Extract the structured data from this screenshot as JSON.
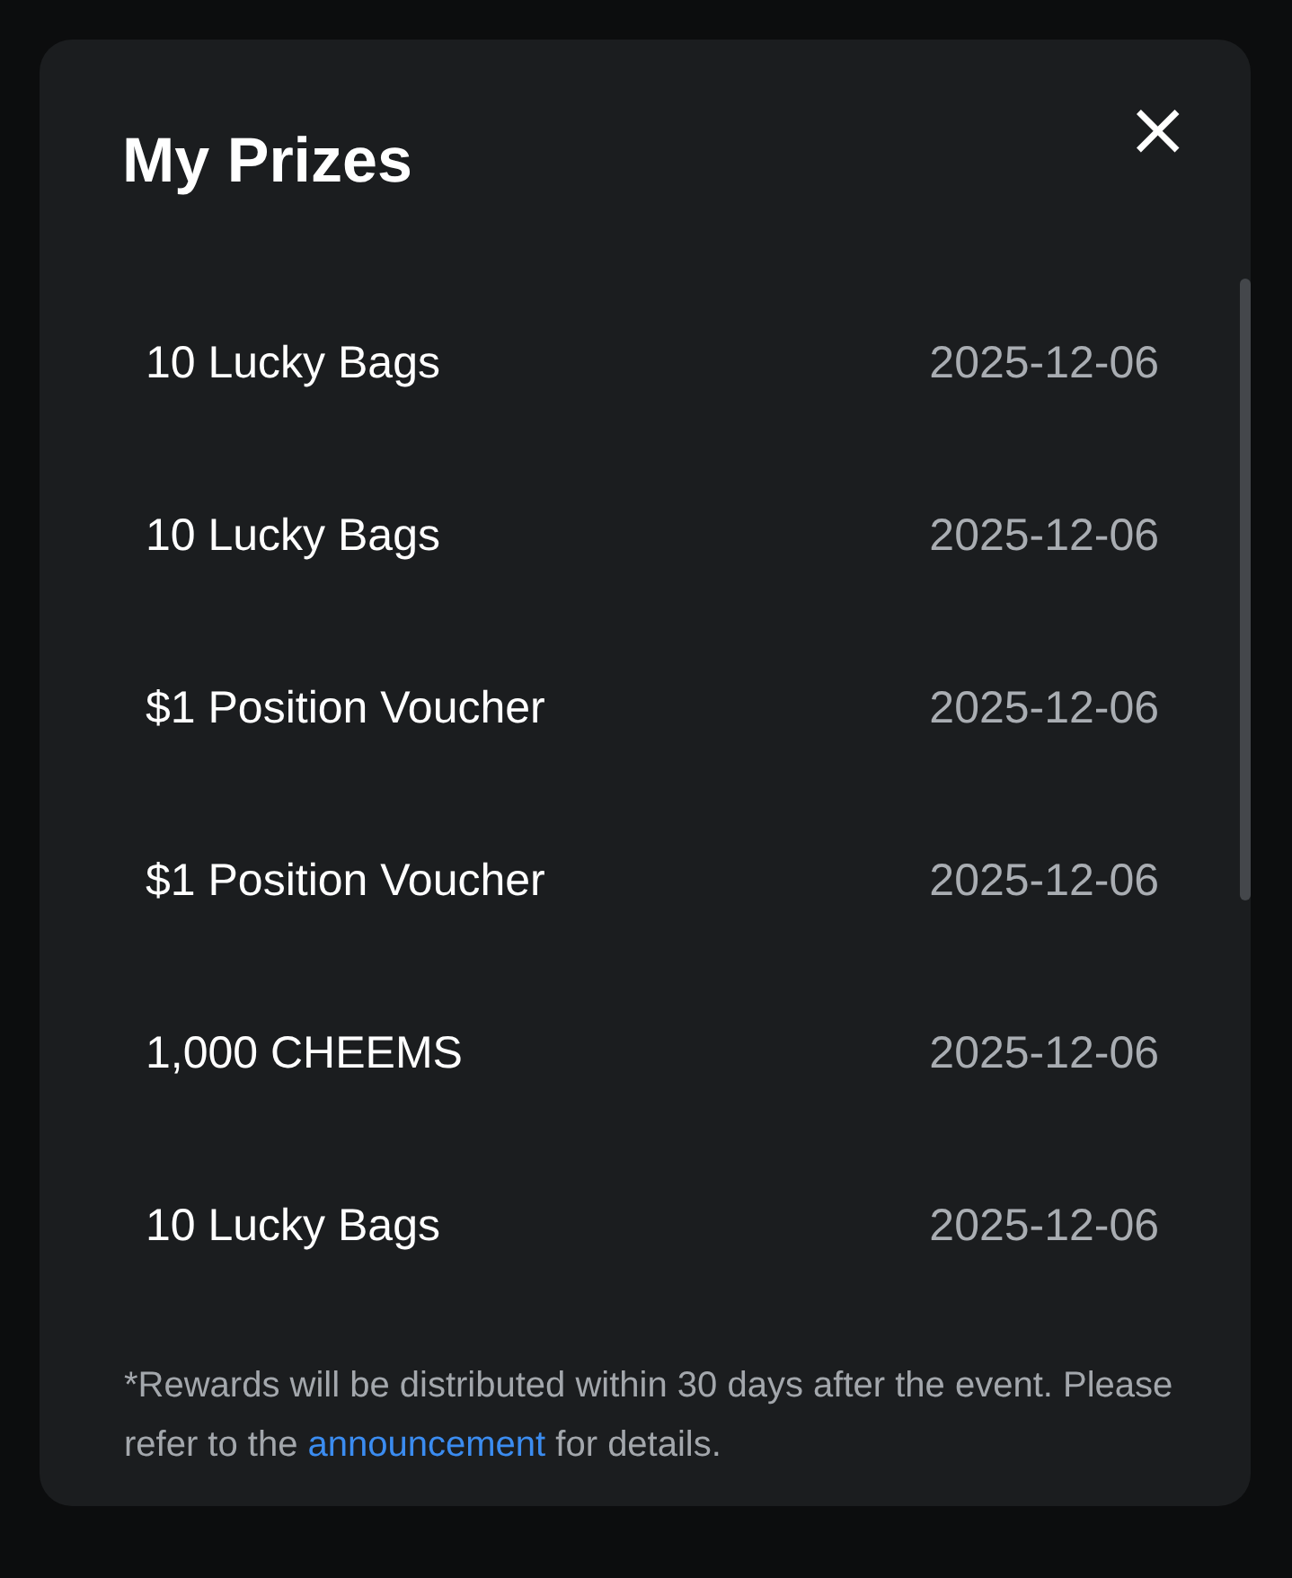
{
  "dialog": {
    "title": "My Prizes",
    "close": "×"
  },
  "prizes": [
    {
      "name": "10 Lucky Bags",
      "date": "2025-12-06"
    },
    {
      "name": "10 Lucky Bags",
      "date": "2025-12-06"
    },
    {
      "name": "$1 Position Voucher",
      "date": "2025-12-06"
    },
    {
      "name": "$1 Position Voucher",
      "date": "2025-12-06"
    },
    {
      "name": "1,000 CHEEMS",
      "date": "2025-12-06"
    },
    {
      "name": "10 Lucky Bags",
      "date": "2025-12-06"
    }
  ],
  "note": {
    "before": "*Rewards will be distributed within 30 days after the event. Please refer to the ",
    "link": "announcement",
    "after": " for details."
  }
}
